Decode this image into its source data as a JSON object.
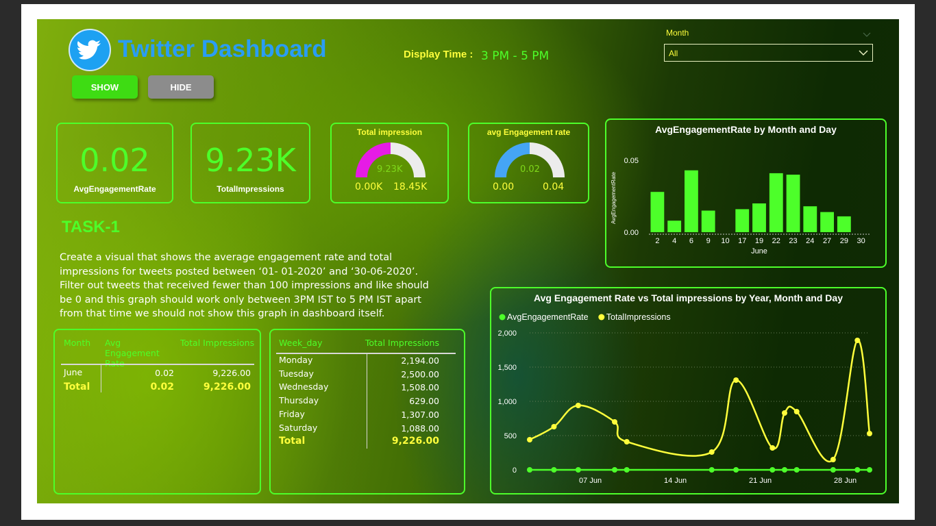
{
  "header": {
    "title": "Twitter Dashboard",
    "show_label": "SHOW",
    "hide_label": "HIDE",
    "display_time_label": "Display Time :",
    "display_time_value": "3 PM - 5 PM"
  },
  "filter": {
    "label": "Month",
    "value": "All"
  },
  "kpis": [
    {
      "value": "0.02",
      "label": "AvgEngagementRate"
    },
    {
      "value": "9.23K",
      "label": "TotalImpressions"
    }
  ],
  "gauges": [
    {
      "title": "Total impression",
      "value_label": "9.23K",
      "min_label": "0.00K",
      "max_label": "18.45K",
      "fill": 0.5,
      "color": "#e61be6"
    },
    {
      "title": "avg Engagement rate",
      "value_label": "0.02",
      "min_label": "0.00",
      "max_label": "0.04",
      "fill": 0.5,
      "color": "#45a5f5"
    }
  ],
  "task": {
    "heading": "TASK-1",
    "description": "Create a visual that shows the average engagement rate and total impressions for tweets posted between ‘01- 01-2020’ and ‘30-06-2020’. Filter out tweets that received fewer than 100 impressions and like should be 0 and this graph should work only between 3PM IST to 5 PM IST apart from that time we should not show this graph in dashboard itself."
  },
  "month_table": {
    "headers": [
      "Month",
      "Avg Engagement Rate",
      "Total Impressions"
    ],
    "row": [
      "June",
      "0.02",
      "9,226.00"
    ],
    "total": [
      "Total",
      "0.02",
      "9,226.00"
    ]
  },
  "week_table": {
    "headers": [
      "Week_day",
      "Total Impressions"
    ],
    "rows": [
      [
        "Monday",
        "2,194.00"
      ],
      [
        "Tuesday",
        "2,500.00"
      ],
      [
        "Wednesday",
        "1,508.00"
      ],
      [
        "Thursday",
        "629.00"
      ],
      [
        "Friday",
        "1,307.00"
      ],
      [
        "Saturday",
        "1,088.00"
      ]
    ],
    "total": [
      "Total",
      "9,226.00"
    ]
  },
  "colors": {
    "accent": "#4dff2a",
    "yellow": "#ffff3c",
    "twitter": "#1da1f2"
  },
  "chart_data": [
    {
      "type": "bar",
      "title": "AvgEngagementRate by Month and Day",
      "ylabel": "AvgEngagementRate",
      "xlabel": "June",
      "categories": [
        "2",
        "4",
        "6",
        "9",
        "10",
        "17",
        "19",
        "22",
        "23",
        "24",
        "27",
        "29",
        "30"
      ],
      "values": [
        0.028,
        0.008,
        0.043,
        0.015,
        0,
        0.016,
        0.02,
        0.041,
        0.04,
        0.018,
        0.014,
        0.011,
        0
      ],
      "yticks": [
        "0.00",
        "0.05"
      ],
      "ylim": [
        0,
        0.05
      ],
      "grid": false,
      "color": "#4dff2a"
    },
    {
      "type": "line",
      "title": "Avg Engagement Rate vs Total impressions by Year, Month and Day",
      "legend": "top-left",
      "series": [
        {
          "name": "AvgEngagementRate",
          "color": "#4dff2a",
          "x": [
            2,
            4,
            6,
            9,
            10,
            17,
            19,
            22,
            23,
            24,
            27,
            29,
            30
          ],
          "values": [
            0.03,
            0.01,
            0.04,
            0.02,
            0,
            0.02,
            0.02,
            0.04,
            0.04,
            0.02,
            0.01,
            0.01,
            0
          ]
        },
        {
          "name": "TotalImpressions",
          "color": "#ffff3c",
          "x": [
            2,
            4,
            6,
            9,
            10,
            17,
            19,
            22,
            23,
            24,
            27,
            29,
            30
          ],
          "values": [
            440,
            630,
            940,
            700,
            410,
            260,
            1310,
            320,
            830,
            850,
            150,
            1890,
            530
          ]
        }
      ],
      "xticks": [
        {
          "x": 7,
          "label": "07 Jun"
        },
        {
          "x": 14,
          "label": "14 Jun"
        },
        {
          "x": 21,
          "label": "21 Jun"
        },
        {
          "x": 28,
          "label": "28 Jun"
        }
      ],
      "xlim": [
        2,
        30
      ],
      "yticks": [
        "0",
        "500",
        "1,000",
        "1,500",
        "2,000"
      ],
      "ylim": [
        0,
        2000
      ],
      "grid": true
    }
  ]
}
